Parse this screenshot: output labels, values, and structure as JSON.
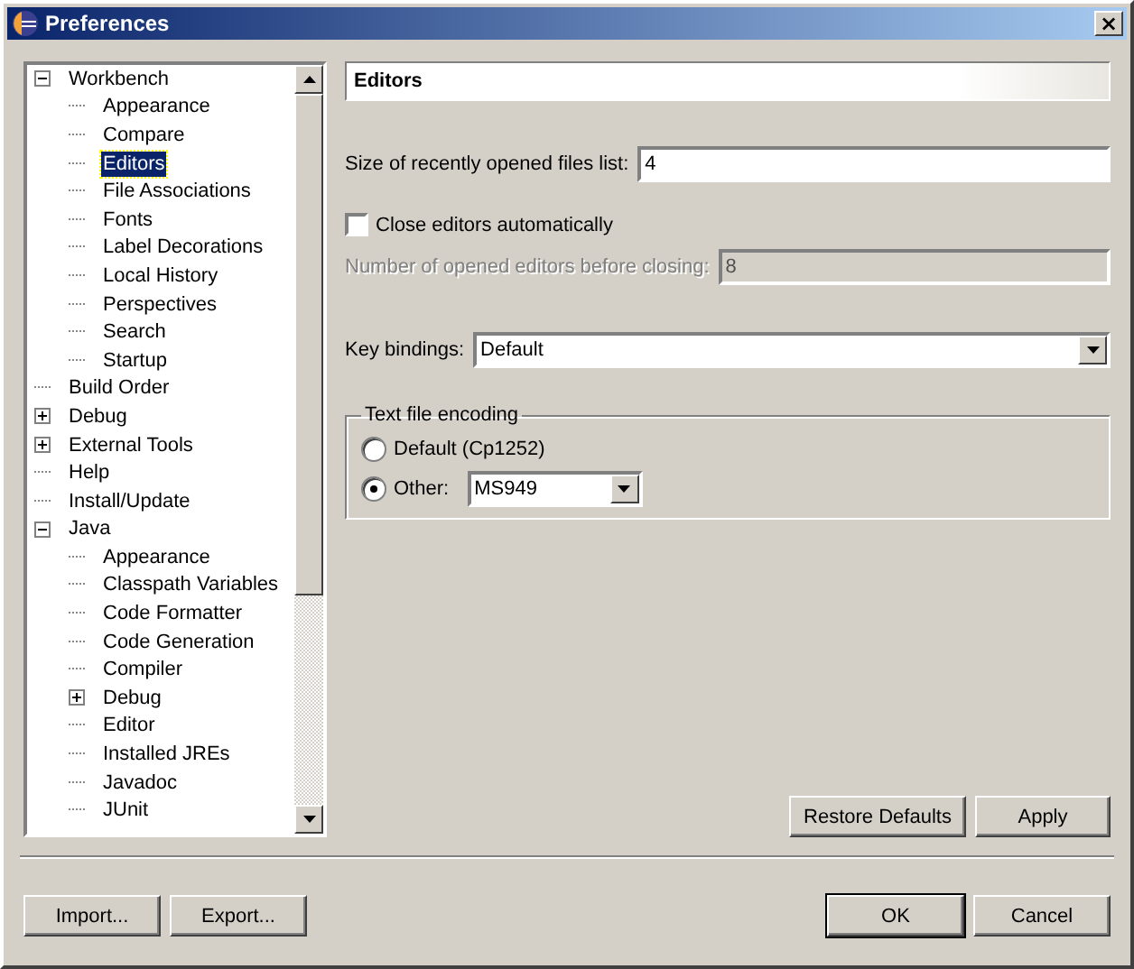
{
  "window": {
    "title": "Preferences",
    "close": "×"
  },
  "tree": [
    {
      "label": "Workbench",
      "selected": false,
      "expanded": true,
      "children": [
        {
          "label": "Appearance",
          "selected": false
        },
        {
          "label": "Compare",
          "selected": false
        },
        {
          "label": "Editors",
          "selected": true
        },
        {
          "label": "File Associations",
          "selected": false
        },
        {
          "label": "Fonts",
          "selected": false
        },
        {
          "label": "Label Decorations",
          "selected": false
        },
        {
          "label": "Local History",
          "selected": false
        },
        {
          "label": "Perspectives",
          "selected": false
        },
        {
          "label": "Search",
          "selected": false
        },
        {
          "label": "Startup",
          "selected": false
        }
      ]
    },
    {
      "label": "Build Order",
      "selected": false
    },
    {
      "label": "Debug",
      "selected": false,
      "expanded": false
    },
    {
      "label": "External Tools",
      "selected": false,
      "expanded": false
    },
    {
      "label": "Help",
      "selected": false
    },
    {
      "label": "Install/Update",
      "selected": false
    },
    {
      "label": "Java",
      "selected": false,
      "expanded": true,
      "children": [
        {
          "label": "Appearance",
          "selected": false
        },
        {
          "label": "Classpath Variables",
          "selected": false
        },
        {
          "label": "Code Formatter",
          "selected": false
        },
        {
          "label": "Code Generation",
          "selected": false
        },
        {
          "label": "Compiler",
          "selected": false
        },
        {
          "label": "Debug",
          "selected": false,
          "expanded": false
        },
        {
          "label": "Editor",
          "selected": false
        },
        {
          "label": "Installed JREs",
          "selected": false
        },
        {
          "label": "Javadoc",
          "selected": false
        },
        {
          "label": "JUnit",
          "selected": false
        }
      ]
    }
  ],
  "page": {
    "title": "Editors",
    "recent_files": {
      "label": "Size of recently opened files list:",
      "value": "4"
    },
    "close_editors": {
      "label": "Close editors automatically",
      "checked": false
    },
    "editors_before_closing": {
      "label": "Number of opened editors before closing:",
      "value": "8",
      "disabled": true
    },
    "key_bindings": {
      "label": "Key bindings:",
      "value": "Default"
    },
    "encoding": {
      "title": "Text file encoding",
      "options": [
        {
          "label": "Default (Cp1252)",
          "selected": false
        },
        {
          "label": "Other:",
          "selected": true,
          "value": "MS949"
        }
      ]
    },
    "buttons": [
      "Restore Defaults",
      "Apply"
    ]
  },
  "footer": {
    "left_buttons": [
      "Import...",
      "Export..."
    ],
    "right_buttons": [
      "OK",
      "Cancel"
    ]
  }
}
